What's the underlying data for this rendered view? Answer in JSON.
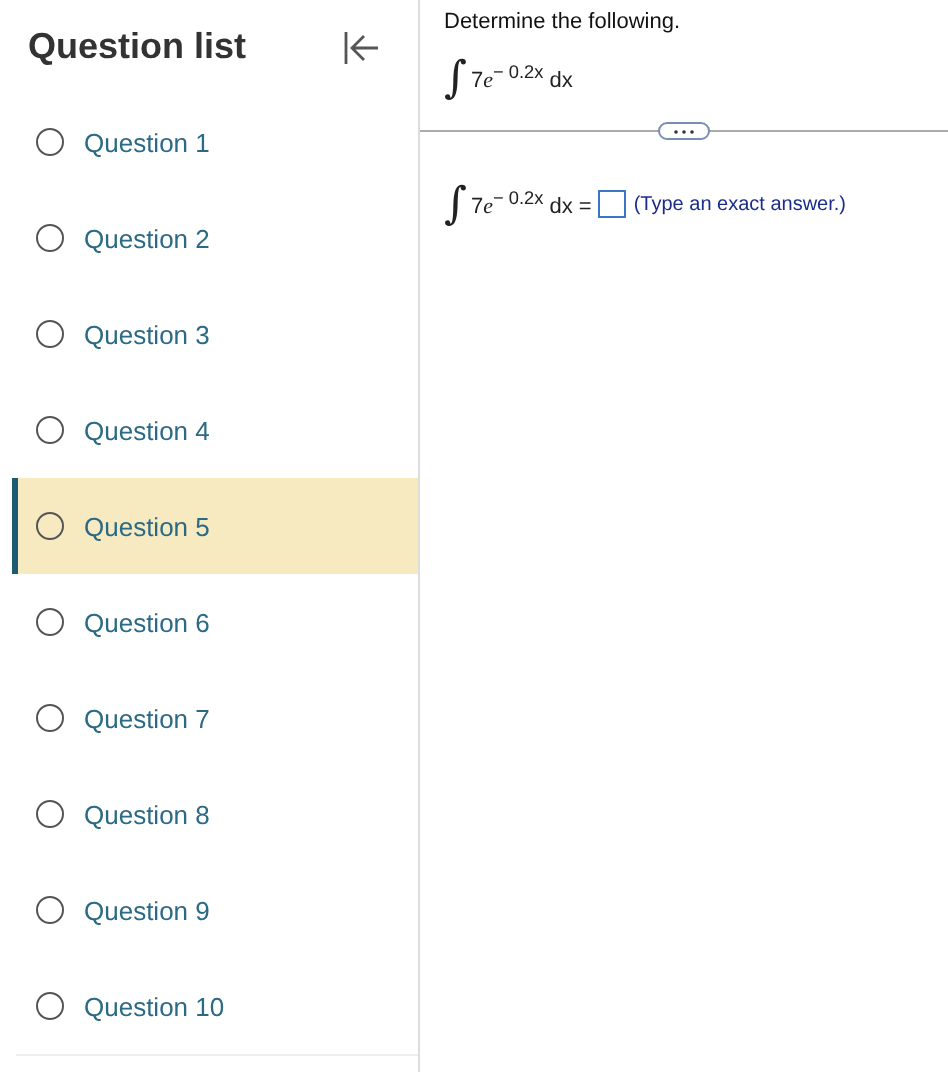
{
  "sidebar": {
    "title": "Question list",
    "items": [
      {
        "label": "Question 1",
        "selected": false
      },
      {
        "label": "Question 2",
        "selected": false
      },
      {
        "label": "Question 3",
        "selected": false
      },
      {
        "label": "Question 4",
        "selected": false
      },
      {
        "label": "Question 5",
        "selected": true
      },
      {
        "label": "Question 6",
        "selected": false
      },
      {
        "label": "Question 7",
        "selected": false
      },
      {
        "label": "Question 8",
        "selected": false
      },
      {
        "label": "Question 9",
        "selected": false
      },
      {
        "label": "Question 10",
        "selected": false
      }
    ]
  },
  "question": {
    "prompt": "Determine the following.",
    "integral_sign": "∫",
    "expression": {
      "coefficient": "7",
      "base": "e",
      "exponent": "− 0.2x",
      "tail": "dx"
    },
    "answer": {
      "integral_sign": "∫",
      "expression": {
        "coefficient": "7",
        "base": "e",
        "exponent": "− 0.2x",
        "tail": "dx ="
      },
      "hint": "(Type an exact answer.)"
    }
  }
}
